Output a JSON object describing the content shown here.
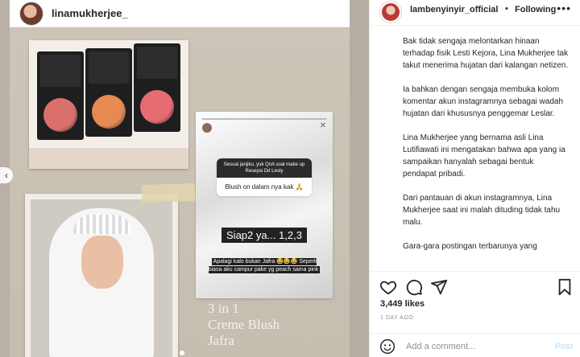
{
  "post_author": {
    "left_username": "linamukherjee_",
    "right_username": "lambenyinyir_official",
    "separator": "•",
    "follow_status": "Following",
    "more_icon": "more-dots-icon"
  },
  "photo": {
    "story_card": {
      "question_header": "Sesuai janjiku, yuk QnA soal make up Resepsi Dd Lesty",
      "question_answer": "Blush on dalam nya kak 🙏",
      "reply_big": "Siap2 ya... 1,2,3",
      "reply_small": "Apalagi kalo bukan Jafra 😂😂😂 Seperti biasa aku campur pake yg peach sama pink"
    },
    "overlay_text_line1": "3 in 1",
    "overlay_text_line2": "Creme Blush",
    "overlay_text_line3": "Jafra",
    "prev_arrow": "‹",
    "blush_colors": [
      "#d9706c",
      "#e58a52",
      "#e56d72"
    ]
  },
  "caption": {
    "paragraphs": [
      "Bak tidak sengaja melontarkan hinaan terhadap fisik Lesti Kejora, Lina Mukherjee tak takut menerima hujatan dari kalangan netizen.",
      "Ia bahkan dengan sengaja membuka kolom komentar akun instagramnya sebagai wadah hujatan dari khususnya penggemar Leslar.",
      "Lina Mukherjee yang bernama asli Lina Lutifiawati ini mengatakan bahwa apa yang ia sampaikan hanyalah sebagai bentuk pendapat pribadi.",
      "Dari pantauan di akun instagramnya, Lina Mukherjee saat ini malah dituding tidak tahu malu.",
      "Gara-gara postingan terbarunya yang"
    ]
  },
  "actions": {
    "like_icon": "heart-icon",
    "comment_icon": "comment-icon",
    "share_icon": "share-icon",
    "save_icon": "bookmark-icon"
  },
  "likes_text": "3,449 likes",
  "time_ago": "1 DAY AGO",
  "comment": {
    "placeholder": "Add a comment...",
    "post_label": "Post",
    "emoji_icon": "emoji-icon"
  }
}
